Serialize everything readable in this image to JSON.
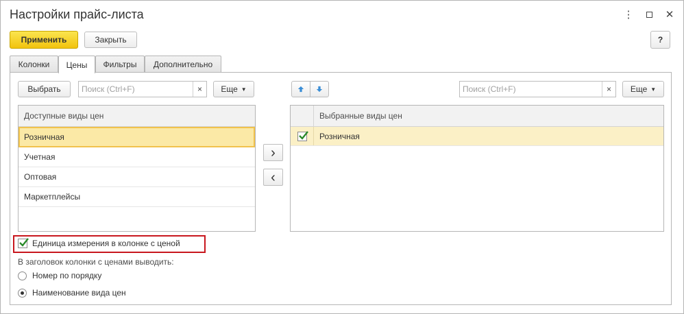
{
  "window": {
    "title": "Настройки прайс-листа",
    "more_icon": "⋮",
    "close_icon": "✕"
  },
  "toolbar": {
    "apply_label": "Применить",
    "close_label": "Закрыть",
    "help_label": "?"
  },
  "tabs": [
    {
      "label": "Колонки",
      "active": false
    },
    {
      "label": "Цены",
      "active": true
    },
    {
      "label": "Фильтры",
      "active": false
    },
    {
      "label": "Дополнительно",
      "active": false
    }
  ],
  "left": {
    "select_label": "Выбрать",
    "search_placeholder": "Поиск (Ctrl+F)",
    "clear_icon": "×",
    "more_label": "Еще",
    "header": "Доступные виды цен",
    "items": [
      "Розничная",
      "Учетная",
      "Оптовая",
      "Маркетплейсы"
    ]
  },
  "right": {
    "search_placeholder": "Поиск (Ctrl+F)",
    "clear_icon": "×",
    "more_label": "Еще",
    "header": "Выбранные виды цен",
    "items": [
      {
        "label": "Розничная",
        "checked": true
      }
    ]
  },
  "transfer": {
    "add_icon": "›",
    "remove_icon": "‹"
  },
  "options": {
    "unit_checkbox_label": "Единица измерения в колонке с ценой",
    "unit_checked": true,
    "header_caption": "В заголовок колонки с ценами выводить:",
    "radio_options": [
      "Номер по порядку",
      "Наименование вида цен"
    ],
    "radio_selected": 1
  },
  "colors": {
    "accent": "#f2c30e",
    "highlight_border": "#c8161d",
    "checkmark": "#2a8a2a",
    "move_arrow": "#3b8ed6"
  }
}
